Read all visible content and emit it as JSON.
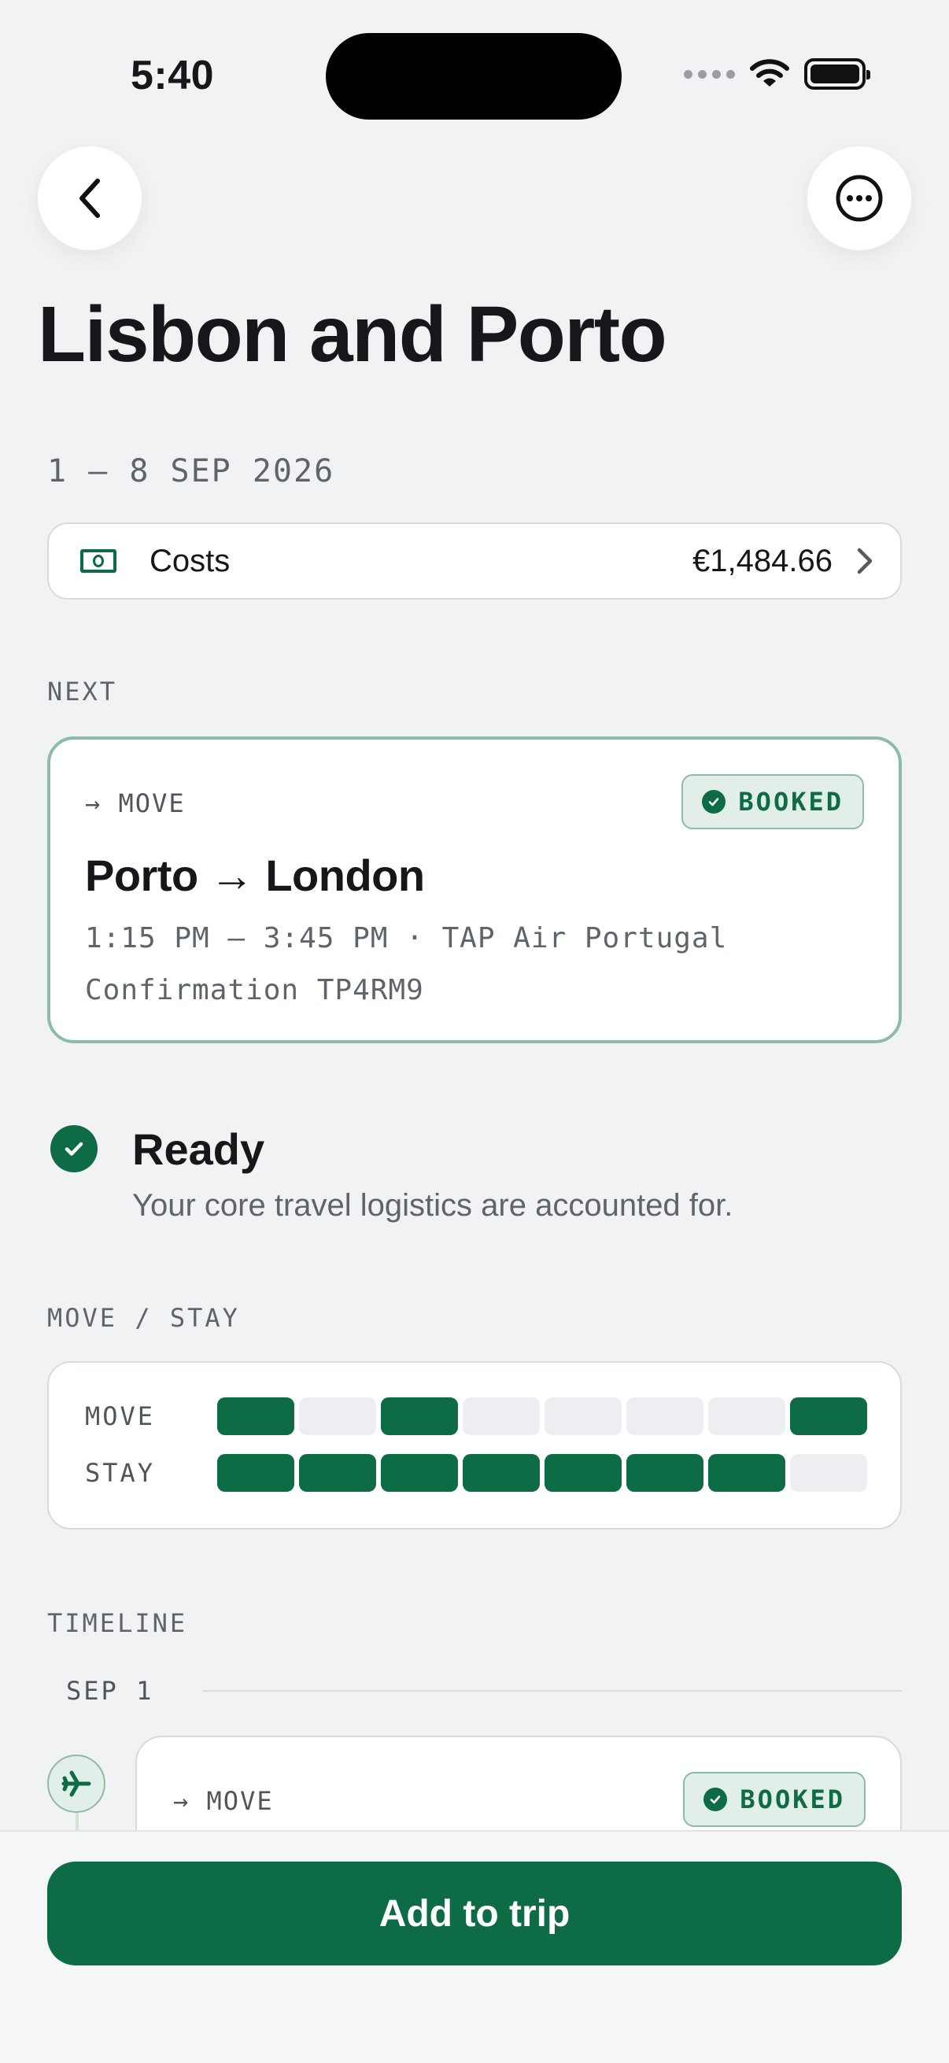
{
  "status_bar": {
    "time": "5:40"
  },
  "header": {
    "title": "Lisbon and Porto",
    "back_icon": "chevron-left-icon",
    "more_icon": "ellipsis-circle-icon"
  },
  "trip": {
    "dates": "1 — 8 SEP 2026",
    "costs": {
      "label": "Costs",
      "value": "€1,484.66",
      "icon": "banknote-icon"
    }
  },
  "next": {
    "section_label": "NEXT",
    "kicker": "→ MOVE",
    "badge": "BOOKED",
    "route": "Porto → London",
    "time_line": "1:15 PM — 3:45 PM · TAP Air Portugal",
    "confirmation": "Confirmation TP4RM9"
  },
  "readiness": {
    "title": "Ready",
    "subtitle": "Your core travel logistics are accounted for."
  },
  "move_stay": {
    "section_label": "MOVE / STAY",
    "rows": [
      {
        "label": "MOVE",
        "days": [
          1,
          0,
          1,
          0,
          0,
          0,
          0,
          1
        ]
      },
      {
        "label": "STAY",
        "days": [
          1,
          1,
          1,
          1,
          1,
          1,
          1,
          0
        ]
      }
    ]
  },
  "timeline": {
    "section_label": "TIMELINE",
    "days": [
      {
        "label": "SEP 1",
        "items": [
          {
            "kicker": "→ MOVE",
            "badge": "BOOKED",
            "icon": "airplane-icon"
          }
        ]
      }
    ]
  },
  "actions": {
    "primary_label": "Add to trip"
  },
  "colors": {
    "accent": "#0D6B45",
    "accent_soft": "#E1EFE8",
    "background": "#F1F2F4"
  }
}
